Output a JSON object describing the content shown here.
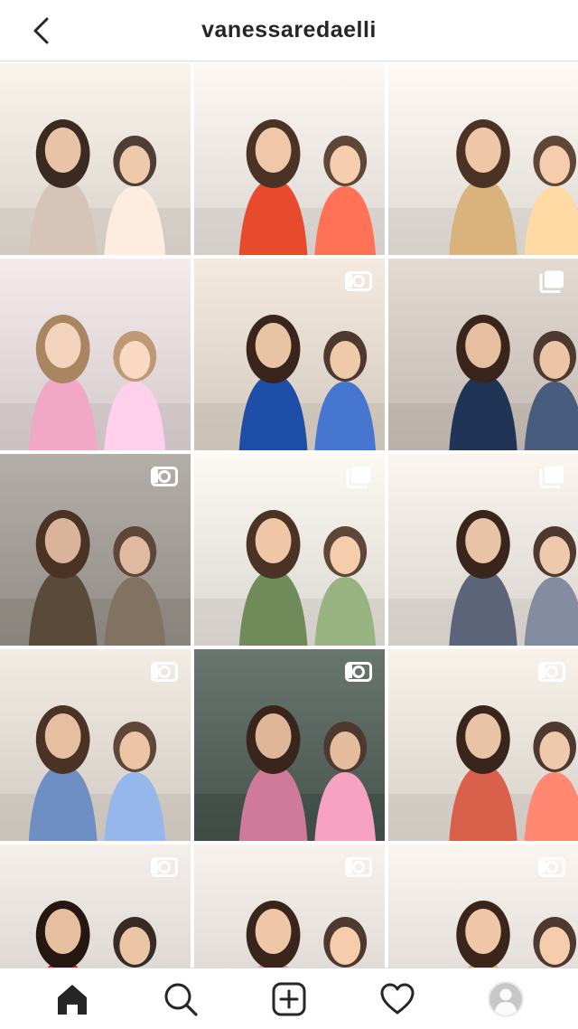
{
  "header": {
    "username": "vanessaredaelli",
    "back_icon": "chevron-left-icon"
  },
  "grid": {
    "posts": [
      {
        "type": "photo",
        "bg": "#efe8e1",
        "accent": "#d6c4b8",
        "skin": "#e9c3a5",
        "hair": "#3b2a22"
      },
      {
        "type": "photo",
        "bg": "#f1ece8",
        "accent": "#e84a2e",
        "skin": "#f0c7a8",
        "hair": "#4a3324"
      },
      {
        "type": "photo",
        "bg": "#f3eee8",
        "accent": "#d9b27c",
        "skin": "#efc6a6",
        "hair": "#4a3324"
      },
      {
        "type": "photo",
        "bg": "#e9dfe0",
        "accent": "#f0a8c4",
        "skin": "#f4d3bd",
        "hair": "#a98561"
      },
      {
        "type": "video",
        "bg": "#e8ded4",
        "accent": "#1f4ea8",
        "skin": "#e8c3a4",
        "hair": "#3a251c"
      },
      {
        "type": "carousel",
        "bg": "#d7cfc7",
        "accent": "#203556",
        "skin": "#e6bfa0",
        "hair": "#3a251c"
      },
      {
        "type": "video",
        "bg": "#a7a39c",
        "accent": "#5a4a3a",
        "skin": "#d9b49a",
        "hair": "#4a3324"
      },
      {
        "type": "carousel",
        "bg": "#f0ece6",
        "accent": "#6e8b59",
        "skin": "#efc6a6",
        "hair": "#4a3324"
      },
      {
        "type": "carousel",
        "bg": "#efe9e4",
        "accent": "#5b6478",
        "skin": "#e9c3a5",
        "hair": "#3a251c"
      },
      {
        "type": "video",
        "bg": "#e6e0d8",
        "accent": "#6e8fc3",
        "skin": "#e6bfa0",
        "hair": "#4a3324"
      },
      {
        "type": "video",
        "bg": "#5c6a63",
        "accent": "#d07a9a",
        "skin": "#e0b699",
        "hair": "#3a251c"
      },
      {
        "type": "video",
        "bg": "#ece6df",
        "accent": "#d9604a",
        "skin": "#e9c3a5",
        "hair": "#3a251c"
      },
      {
        "type": "video",
        "bg": "#e8e3de",
        "accent": "#c81f20",
        "skin": "#e6bfa0",
        "hair": "#241611"
      },
      {
        "type": "video",
        "bg": "#ebe6e2",
        "accent": "#e8968f",
        "skin": "#efc6a6",
        "hair": "#3a251c"
      },
      {
        "type": "video",
        "bg": "#eee9e4",
        "accent": "#e1a94a",
        "skin": "#efc6a6",
        "hair": "#3a251c"
      }
    ]
  },
  "bottom_nav": {
    "items": [
      {
        "name": "home",
        "icon": "home-icon"
      },
      {
        "name": "search",
        "icon": "search-icon"
      },
      {
        "name": "new-post",
        "icon": "add-post-icon"
      },
      {
        "name": "activity",
        "icon": "heart-icon"
      },
      {
        "name": "profile",
        "icon": "avatar-icon"
      }
    ]
  }
}
